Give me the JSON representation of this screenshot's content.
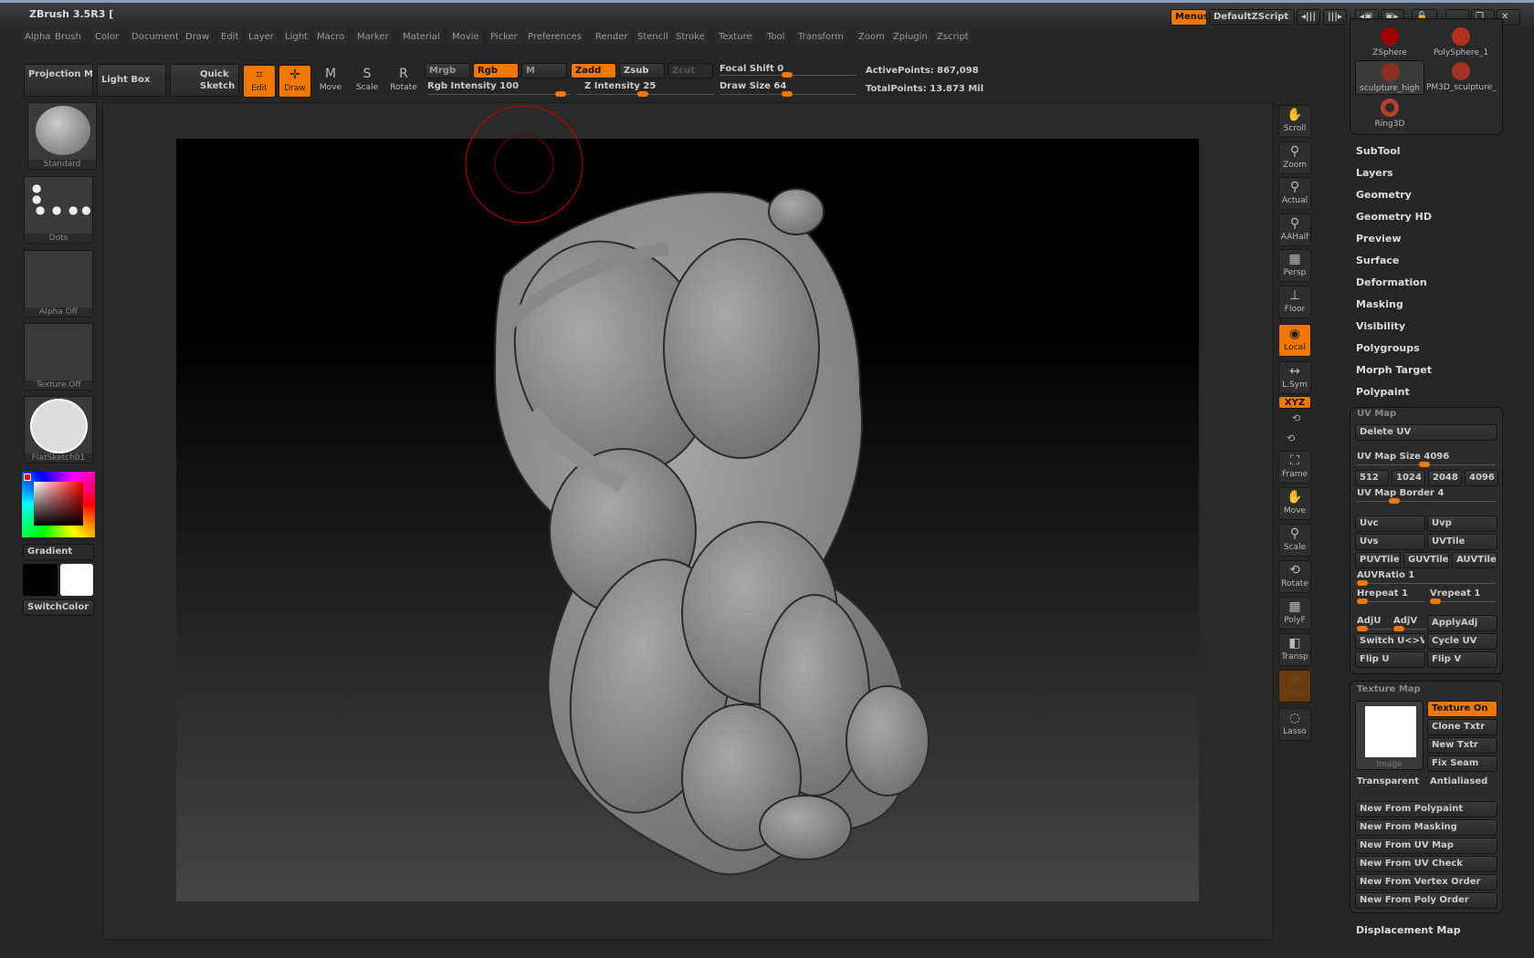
{
  "app": {
    "title": "ZBrush 3.5R3 ["
  },
  "menus": [
    "Alpha",
    "Brush",
    "Color",
    "Document",
    "Draw",
    "Edit",
    "Layer",
    "Light",
    "Macro",
    "Marker",
    "Material",
    "Movie",
    "Picker",
    "Preferences",
    "Render",
    "Stencil",
    "Stroke",
    "Texture",
    "Tool",
    "Transform",
    "Zoom",
    "Zplugin",
    "Zscript"
  ],
  "topright": {
    "menus": "Menus",
    "script": "DefaultZScript"
  },
  "shelf": {
    "projection_master": "Projection Master",
    "light_box": "Light Box",
    "quick_sketch": "Quick Sketch",
    "edit": "Edit",
    "draw": "Draw",
    "move": "Move",
    "scale": "Scale",
    "rotate": "Rotate",
    "mrgb": "Mrgb",
    "rgb": "Rgb",
    "m": "M",
    "zadd": "Zadd",
    "zsub": "Zsub",
    "zcut": "Zcut",
    "rgb_intensity": "Rgb Intensity 100",
    "z_intensity": "Z Intensity 25",
    "focal_shift": "Focal Shift 0",
    "draw_size": "Draw Size 64",
    "active_points": "ActivePoints: 867,098",
    "total_points": "TotalPoints: 13.873 Mil",
    "rgb_intensity_value": 100,
    "z_intensity_value": 25,
    "focal_shift_value": 0,
    "draw_size_value": 64
  },
  "left": {
    "brush": "Standard",
    "stroke": "Dots",
    "alpha": "Alpha Off",
    "texture": "Texture Off",
    "material": "FlatSketch01",
    "gradient": "Gradient",
    "switch_color": "SwitchColor",
    "main_color": "#000000",
    "secondary_color": "#ffffff"
  },
  "right_shelf": [
    "Scroll",
    "Zoom",
    "Actual",
    "AAHalf",
    "Persp",
    "Floor",
    "Local",
    "L.Sym",
    "XYZ",
    "Frame",
    "Move",
    "Scale",
    "Rotate",
    "PolyF",
    "Transp",
    "Ghost",
    "Lasso"
  ],
  "tools": [
    "ZSphere",
    "PolySphere_1",
    "sculpture_high",
    "PM3D_sculpture_",
    "Ring3D"
  ],
  "tool_menu": [
    "SubTool",
    "Layers",
    "Geometry",
    "Geometry HD",
    "Preview",
    "Surface",
    "Deformation",
    "Masking",
    "Visibility",
    "Polygroups",
    "Morph Target",
    "Polypaint"
  ],
  "uv": {
    "title": "UV Map",
    "delete": "Delete UV",
    "size": "UV Map Size 4096",
    "sizes": [
      "512",
      "1024",
      "2048",
      "4096"
    ],
    "border": "UV Map Border 4",
    "uvc": "Uvc",
    "uvp": "Uvp",
    "uvs": "Uvs",
    "uvtile": "UVTile",
    "puv": "PUVTiles",
    "guv": "GUVTiles",
    "auv": "AUVTiles",
    "auvratio": "AUVRatio 1",
    "hrepeat": "Hrepeat 1",
    "vrepeat": "Vrepeat 1",
    "adju": "AdjU",
    "adjv": "AdjV",
    "applyadj": "ApplyAdj",
    "switch": "Switch U<>V",
    "cycle": "Cycle UV",
    "flipu": "Flip U",
    "flipv": "Flip V"
  },
  "texmap": {
    "title": "Texture Map",
    "image": "Image",
    "on": "Texture On",
    "clone": "Clone Txtr",
    "new": "New Txtr",
    "fix": "Fix Seam",
    "transparent": "Transparent",
    "antialiased": "Antialiased",
    "new_from": [
      "New From Polypaint",
      "New From Masking",
      "New From UV Map",
      "New From UV Check",
      "New From Vertex Order",
      "New From Poly Order"
    ]
  },
  "displacement": "Displacement Map",
  "colors": {
    "accent": "#f07800"
  }
}
